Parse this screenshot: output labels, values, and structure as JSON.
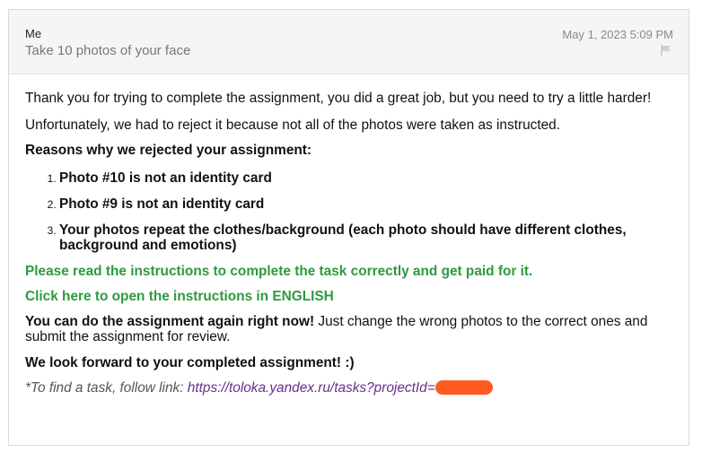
{
  "header": {
    "sender": "Me",
    "subject": "Take 10 photos of your face",
    "date": "May 1, 2023 5:09 PM"
  },
  "body": {
    "paragraph1": "Thank you for trying to complete the assignment, you did a great job, but you need to try a little harder!",
    "paragraph2": "Unfortunately, we had to reject it because not all of the photos were taken as instructed.",
    "reasons_heading": "Reasons why we rejected your assignment:",
    "reasons": [
      "Photo #10 is not an identity card",
      "Photo #9 is not an identity card",
      "Your photos repeat the clothes/background (each photo should have different clothes, background and emotions)"
    ],
    "instructions_notice": "Please read the instructions to complete the task correctly and get paid for it.",
    "instructions_link": "Click here to open the instructions in ENGLISH",
    "redo_bold": "You can do the assignment again right now!",
    "redo_rest": " Just change the wrong photos to the correct ones and submit the assignment for review.",
    "closing": "We look forward to your completed assignment! :)",
    "find_task_prefix": "*To find a task, follow link: ",
    "find_task_link": "https://toloka.yandex.ru/tasks?projectId=",
    "redaction_color": "#ff5a1f"
  },
  "colors": {
    "green_text": "#2e9a3f",
    "link": "#6b2c8f",
    "header_bg": "#f5f5f5"
  },
  "icons": {
    "flag": "flag-icon"
  }
}
